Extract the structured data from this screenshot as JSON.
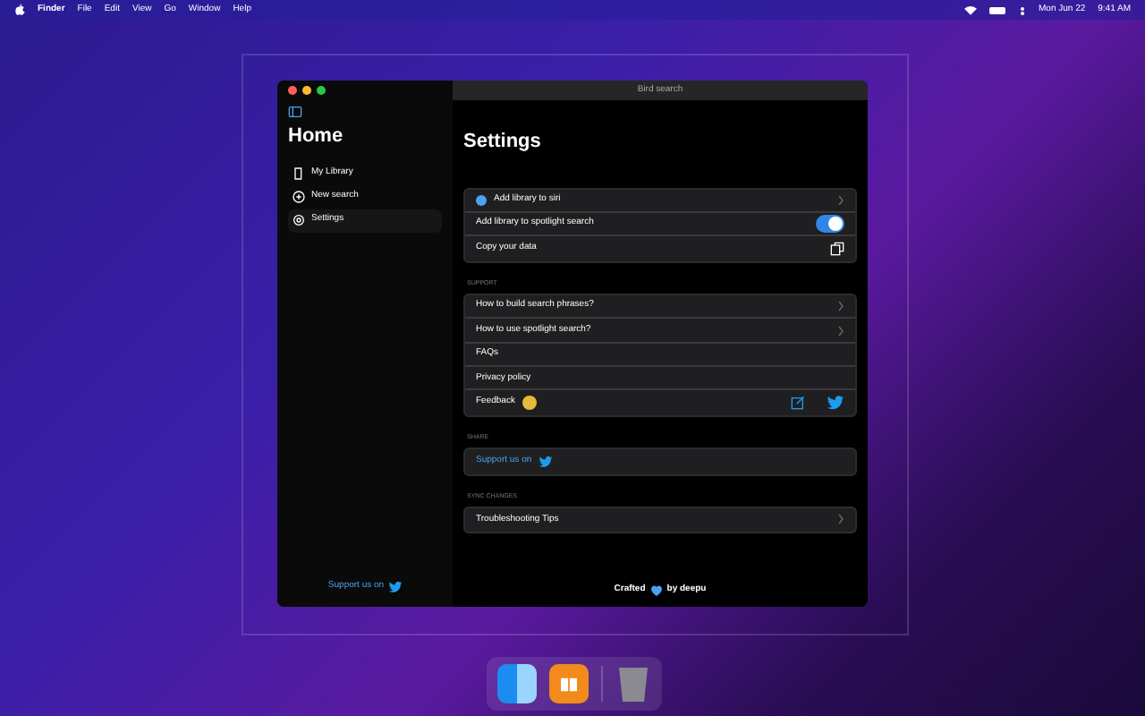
{
  "menu_bar": {
    "app": "Finder",
    "items": [
      "File",
      "Edit",
      "View",
      "Go",
      "Window",
      "Help"
    ],
    "date": "Mon Jun 22",
    "time": "9:41 AM"
  },
  "window": {
    "title": "Bird search"
  },
  "sidebar": {
    "title": "Home",
    "items": [
      {
        "label": "My Library",
        "selected": false
      },
      {
        "label": "New search",
        "selected": false
      },
      {
        "label": "Settings",
        "selected": true
      }
    ],
    "footer": "Support us on"
  },
  "settings": {
    "title": "Settings",
    "sections": [
      {
        "rows": [
          {
            "kind": "siri",
            "label": "Add library to siri"
          },
          {
            "kind": "toggle",
            "label": "Add library to spotlight search",
            "on": true
          },
          {
            "kind": "copy",
            "label": "Copy your data"
          }
        ]
      },
      {
        "header": "SUPPORT",
        "rows": [
          {
            "kind": "link",
            "label": "How to build search phrases?"
          },
          {
            "kind": "link",
            "label": "How to use spotlight search?"
          },
          {
            "kind": "plain",
            "label": "FAQs"
          },
          {
            "kind": "plain",
            "label": "Privacy policy"
          },
          {
            "kind": "feedback",
            "label": "Feedback"
          }
        ]
      },
      {
        "header": "SHARE",
        "rows": [
          {
            "kind": "share",
            "label": "Support us on"
          }
        ]
      },
      {
        "header": "SYNC CHANGES",
        "rows": [
          {
            "kind": "link",
            "label": "Troubleshooting Tips"
          }
        ]
      }
    ],
    "footer_left": "Crafted",
    "footer_right": "by deepu"
  }
}
